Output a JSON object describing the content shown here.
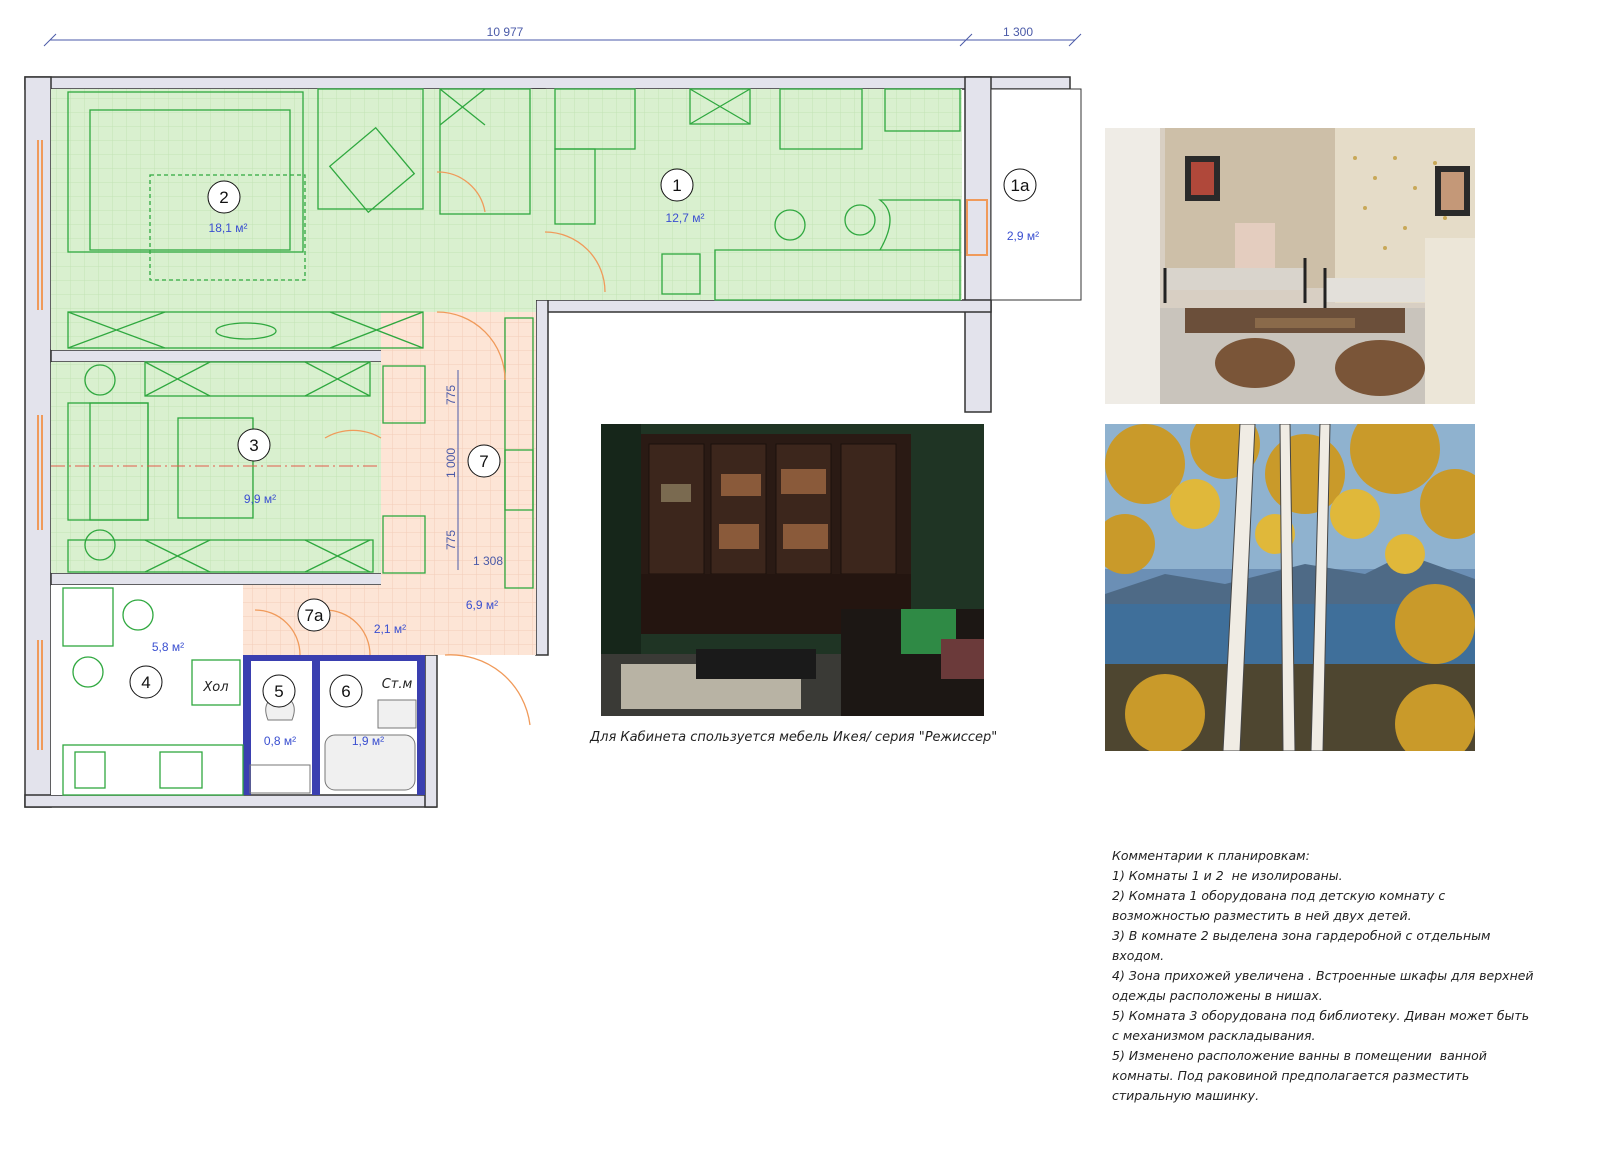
{
  "dimensions": {
    "total_width": "10 977",
    "balcony_width": "1 300",
    "hall_upper": "775",
    "hall_middle": "1 000",
    "hall_lower": "775",
    "hall_width": "1 308"
  },
  "rooms": [
    {
      "num": "1",
      "area": "12,7 м²"
    },
    {
      "num": "1а",
      "area": "2,9 м²"
    },
    {
      "num": "2",
      "area": "18,1 м²"
    },
    {
      "num": "3",
      "area": "9,9 м²"
    },
    {
      "num": "4",
      "area": "5,8 м²"
    },
    {
      "num": "5",
      "area": "0,8 м²"
    },
    {
      "num": "6",
      "area": "1,9 м²"
    },
    {
      "num": "7",
      "area": "6,9 м²"
    },
    {
      "num": "7а",
      "area": "2,1 м²"
    }
  ],
  "labels": {
    "fridge": "Хол",
    "washer": "Ст.м"
  },
  "caption": "Для Кабинета спользуется мебель Икея/ серия \"Режиссер\"",
  "comments": [
    "Комментарии к планировкам:",
    "1) Комнаты 1 и 2  не изолированы.",
    "2) Комната 1 оборудована под детскую комнату с",
    "возможностью разместить в ней двух детей.",
    "3) В комнате 2 выделена зона гардеробной с отдельным",
    "входом.",
    "4) Зона прихожей увеличена . Встроенные шкафы для верхней",
    "одежды расположены в нишах.",
    "5) Комната 3 оборудована под библиотеку. Диван может быть",
    "с механизмом раскладывания.",
    "5) Изменено расположение ванны в помещении  ванной",
    "комнаты. Под раковиной предполагается разместить",
    "стиральную машинку."
  ],
  "colors": {
    "room_fill": "#d9f0cf",
    "hall_fill": "#fde5d6",
    "wall_fill": "#e3e3ec",
    "furniture": "#2fa83f",
    "dim_text": "#4a5aa8"
  }
}
